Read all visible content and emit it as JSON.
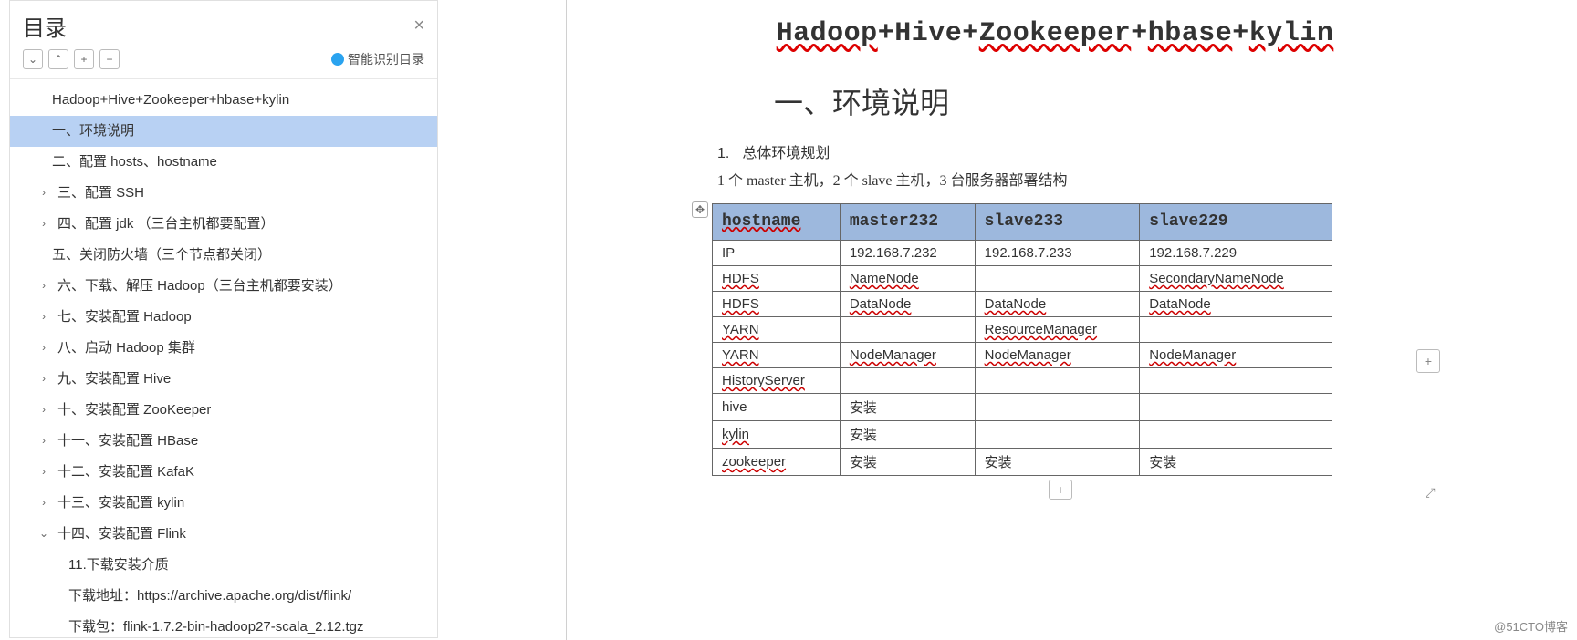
{
  "sidebar": {
    "title": "目录",
    "smart_label": "智能识别目录",
    "toolbar_icons": [
      "chevron-down-icon",
      "chevron-up-icon",
      "plus-icon",
      "minus-icon"
    ],
    "outline": [
      {
        "label": "Hadoop+Hive+Zookeeper+hbase+kylin",
        "level": 0,
        "arrow": "",
        "selected": false
      },
      {
        "label": "一、环境说明",
        "level": 1,
        "arrow": "",
        "selected": true,
        "noarrow": true
      },
      {
        "label": "二、配置 hosts、hostname",
        "level": 1,
        "arrow": "",
        "selected": false,
        "noarrow": true
      },
      {
        "label": "三、配置 SSH",
        "level": 1,
        "arrow": ">",
        "selected": false
      },
      {
        "label": "四、配置 jdk （三台主机都要配置）",
        "level": 1,
        "arrow": ">",
        "selected": false
      },
      {
        "label": "五、关闭防火墙（三个节点都关闭）",
        "level": 1,
        "arrow": "",
        "selected": false,
        "noarrow": true
      },
      {
        "label": "六、下载、解压 Hadoop（三台主机都要安装）",
        "level": 1,
        "arrow": ">",
        "selected": false
      },
      {
        "label": "七、安装配置 Hadoop",
        "level": 1,
        "arrow": ">",
        "selected": false
      },
      {
        "label": "八、启动 Hadoop 集群",
        "level": 1,
        "arrow": ">",
        "selected": false
      },
      {
        "label": "九、安装配置 Hive",
        "level": 1,
        "arrow": ">",
        "selected": false
      },
      {
        "label": "十、安装配置 ZooKeeper",
        "level": 1,
        "arrow": ">",
        "selected": false
      },
      {
        "label": "十一、安装配置 HBase",
        "level": 1,
        "arrow": ">",
        "selected": false
      },
      {
        "label": "十二、安装配置 KafaK",
        "level": 1,
        "arrow": ">",
        "selected": false
      },
      {
        "label": "十三、安装配置 kylin",
        "level": 1,
        "arrow": ">",
        "selected": false
      },
      {
        "label": "十四、安装配置 Flink",
        "level": 1,
        "arrow": "v",
        "selected": false
      },
      {
        "label": "11.下载安装介质",
        "level": 2,
        "arrow": "",
        "selected": false
      },
      {
        "label": "下载地址：https://archive.apache.org/dist/flink/",
        "level": 2,
        "arrow": "",
        "selected": false
      },
      {
        "label": "下载包：flink-1.7.2-bin-hadoop27-scala_2.12.tgz",
        "level": 2,
        "arrow": "",
        "selected": false
      }
    ]
  },
  "document": {
    "title_parts": [
      "Hadoop",
      "+Hive+",
      "Zookeeper",
      "+",
      "hbase",
      "+",
      "kylin"
    ],
    "heading1": "一、环境说明",
    "list_num": "1.",
    "list_text": "总体环境规划",
    "desc": "1 个 master 主机，2 个 slave 主机，3 台服务器部署结构",
    "bottom_cut": "",
    "table": {
      "headers": [
        "hostname",
        "master232",
        "slave233",
        "slave229"
      ],
      "rows": [
        [
          "IP",
          "192.168.7.232",
          "192.168.7.233",
          "192.168.7.229"
        ],
        [
          "HDFS",
          "NameNode",
          "",
          "SecondaryNameNode"
        ],
        [
          "HDFS",
          "DataNode",
          "DataNode",
          "DataNode"
        ],
        [
          "YARN",
          "",
          "ResourceManager",
          ""
        ],
        [
          "YARN",
          "NodeManager",
          "NodeManager",
          "NodeManager"
        ],
        [
          "HistoryServer",
          "",
          "",
          ""
        ],
        [
          "hive",
          "安装",
          "",
          ""
        ],
        [
          "kylin",
          "安装",
          "",
          ""
        ],
        [
          "zookeeper",
          "安装",
          "安装",
          "安装"
        ]
      ],
      "wavy_cells": [
        "NameNode",
        "SecondaryNameNode",
        "DataNode",
        "ResourceManager",
        "NodeManager",
        "HistoryServer",
        "kylin",
        "HDFS",
        "hostname",
        "YARN",
        "zookeeper"
      ]
    }
  },
  "watermark": "@51CTO博客",
  "glyphs": {
    "plus": "+",
    "minus": "−",
    "close": "×",
    "move": "✥",
    "expand": "⤢",
    "chev_down": "⌄",
    "chev_up": "⌃",
    "chev_right": "›",
    "chev_down_open": "⌄"
  }
}
